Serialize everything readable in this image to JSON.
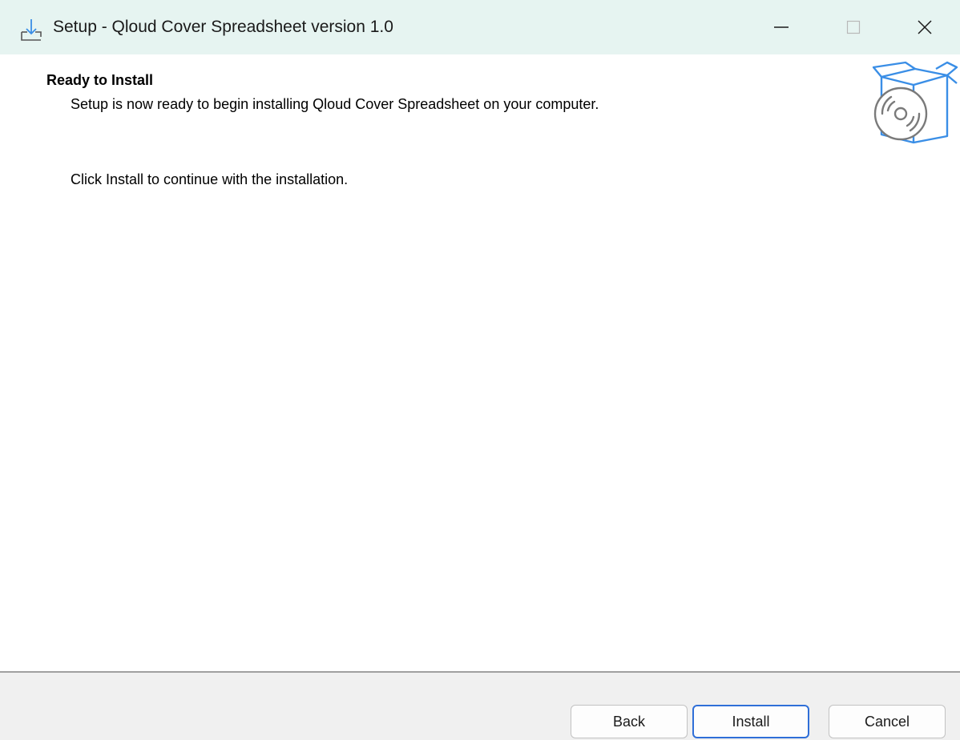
{
  "window": {
    "title": "Setup - Qloud Cover Spreadsheet version 1.0",
    "icon": "setup-download-icon",
    "controls": {
      "minimize_icon": "minimize-icon",
      "maximize_icon": "maximize-icon",
      "close_icon": "close-icon"
    }
  },
  "header": {
    "title": "Ready to Install",
    "subtitle": "Setup is now ready to begin installing Qloud Cover Spreadsheet on your computer.",
    "art_icon": "box-disc-icon"
  },
  "body": {
    "instruction": "Click Install to continue with the installation."
  },
  "footer": {
    "back_label": "Back",
    "install_label": "Install",
    "cancel_label": "Cancel"
  },
  "colors": {
    "titlebar_bg": "#e6f4f1",
    "accent": "#2f6fd8",
    "icon_blue": "#3a8ee6",
    "footer_bg": "#f0f0f0"
  }
}
